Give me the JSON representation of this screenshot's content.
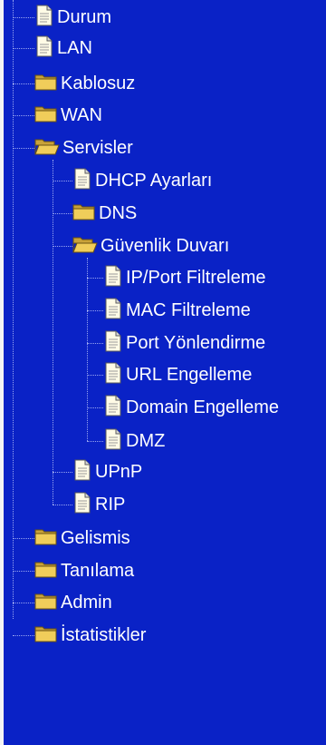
{
  "tree": {
    "durum": "Durum",
    "lan": "LAN",
    "kablosuz": "Kablosuz",
    "wan": "WAN",
    "servisler": {
      "label": "Servisler",
      "dhcp": "DHCP Ayarları",
      "dns": "DNS",
      "guvenlik": {
        "label": "Güvenlik Duvarı",
        "ip_port": "IP/Port Filtreleme",
        "mac": "MAC Filtreleme",
        "port": "Port Yönlendirme",
        "url": "URL Engelleme",
        "domain": "Domain Engelleme",
        "dmz": "DMZ"
      },
      "upnp": "UPnP",
      "rip": "RIP"
    },
    "gelismis": "Gelismis",
    "tanilama": "Tanılama",
    "admin": "Admin",
    "istatistikler": "İstatistikler"
  },
  "colors": {
    "background": "#0a22c6",
    "text": "#ffffff",
    "folder": "#e8c24a",
    "page": "#fffbe6"
  },
  "icons": {
    "page": "document-icon",
    "folder_closed": "folder-icon",
    "folder_open": "open-folder-icon"
  }
}
